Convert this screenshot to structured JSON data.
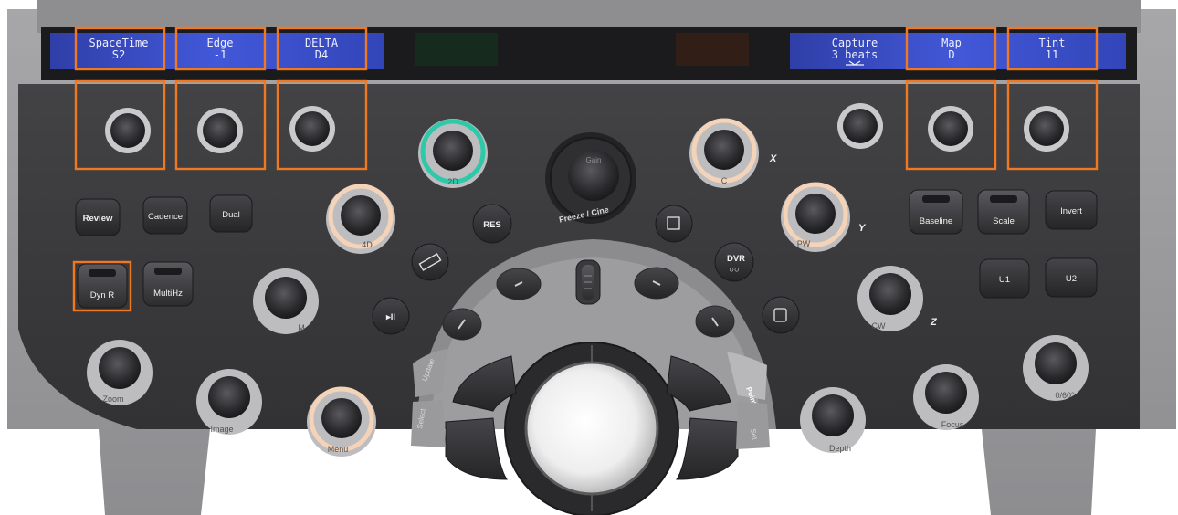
{
  "display_left": {
    "items": [
      {
        "name": "SpaceTime",
        "value": "S2"
      },
      {
        "name": "Edge",
        "value": "-1"
      },
      {
        "name": "DELTA",
        "value": "D4"
      }
    ]
  },
  "display_right": {
    "items": [
      {
        "name": "Capture",
        "value": "3 beats"
      },
      {
        "name": "Map",
        "value": "D"
      },
      {
        "name": "Tint",
        "value": "11"
      }
    ]
  },
  "left_buttons": {
    "review": "Review",
    "cadence": "Cadence",
    "dual": "Dual",
    "dyn_r": "Dyn R",
    "multihz": "MultiHz"
  },
  "right_buttons": {
    "baseline": "Baseline",
    "scale": "Scale",
    "invert": "Invert",
    "u1": "U1",
    "u2": "U2"
  },
  "knobs": {
    "mode_2d": "2D",
    "mode_4d": "4D",
    "mode_m": "M",
    "mode_c": "C",
    "mode_pw": "PW",
    "mode_cw": "CW",
    "zoom": "Zoom",
    "image": "Image",
    "menu": "Menu",
    "depth": "Depth",
    "focus": "Focus",
    "angle": "0/60°"
  },
  "center": {
    "gain": "Gain",
    "freeze_cine": "Freeze / Cine",
    "res": "RES",
    "dvr": "DVR"
  },
  "trackball_area": {
    "update": "Update",
    "select": "Select",
    "pointer": "Pointer",
    "set": "Set"
  },
  "axis_labels": {
    "x": "X",
    "y": "Y",
    "z": "Z"
  },
  "colors": {
    "panel": "#3a3a3c",
    "screen": "#3d4fd0",
    "highlight": "#f07820",
    "ring_2d": "#2ec9a8",
    "ring_warm": "#f4d3b8"
  }
}
